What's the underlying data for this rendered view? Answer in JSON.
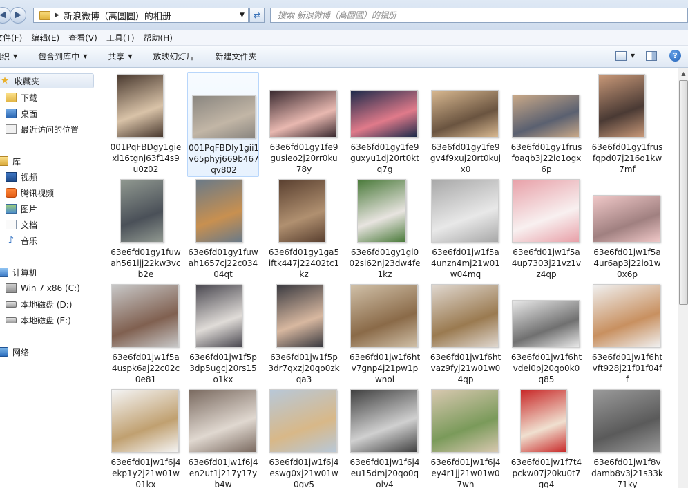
{
  "address": {
    "path_label": "新浪微博（高圆圆）的相册",
    "search_placeholder": "搜索 新浪微博（高圆圆）的相册"
  },
  "menu": [
    "文件(F)",
    "编辑(E)",
    "查看(V)",
    "工具(T)",
    "帮助(H)"
  ],
  "toolbar": {
    "organize": "组织",
    "include_library": "包含到库中",
    "share": "共享",
    "slideshow": "放映幻灯片",
    "new_folder": "新建文件夹"
  },
  "nav": {
    "favorites": "收藏夹",
    "downloads": "下载",
    "desktop": "桌面",
    "recent": "最近访问的位置",
    "libraries": "库",
    "videos": "视频",
    "tencent_video": "腾讯视频",
    "pictures": "图片",
    "documents": "文档",
    "music": "音乐",
    "computer": "计算机",
    "drive_c": "Win 7 x86 (C:)",
    "drive_d": "本地磁盘 (D:)",
    "drive_e": "本地磁盘 (E:)",
    "network": "网络"
  },
  "files": [
    {
      "name": "001PqFBDgy1giexl16tgnj63f14s9u0z02",
      "colors": [
        "#4a3a30",
        "#d9c3a8"
      ]
    },
    {
      "name": "001PqFBDly1gii1v65phyj669b467qv802",
      "colors": [
        "#8a8680",
        "#c2b6a6"
      ]
    },
    {
      "name": "63e6fd01gy1fe9gusieo2j20rr0ku78y",
      "colors": [
        "#3a2a30",
        "#e8b8b0"
      ]
    },
    {
      "name": "63e6fd01gy1fe9guxyu1dj20rt0ktq7g",
      "colors": [
        "#1c2a4a",
        "#e07a8a"
      ]
    },
    {
      "name": "63e6fd01gy1fe9gv4f9xuj20rt0kujx0",
      "colors": [
        "#d8b890",
        "#6a5440"
      ]
    },
    {
      "name": "63e6fd01gy1frusfoaqb3j22io1ogx6p",
      "colors": [
        "#c8a888",
        "#5a6070"
      ]
    },
    {
      "name": "63e6fd01gy1frusfqpd07j216o1kw7mf",
      "colors": [
        "#c89878",
        "#4a3a34"
      ]
    },
    {
      "name": "63e6fd01gy1fuwah561ljj22kw3vcb2e",
      "colors": [
        "#909890",
        "#4a5058"
      ]
    },
    {
      "name": "63e6fd01gy1fuwah1657cj22c03404qt",
      "colors": [
        "#6a7a88",
        "#c89050"
      ]
    },
    {
      "name": "63e6fd01gy1ga5iftk447j22402tc1kz",
      "colors": [
        "#5a4030",
        "#b09070"
      ]
    },
    {
      "name": "63e6fd01gy1gi002sl62nj23dw4fe1kz",
      "colors": [
        "#4a7a3a",
        "#e8e4e0"
      ]
    },
    {
      "name": "63e6fd01jw1f5a4unzn4mj21w01w04mq",
      "colors": [
        "#a8a8a8",
        "#e8e8e8"
      ]
    },
    {
      "name": "63e6fd01jw1f5a4up7303j21vz1vz4qp",
      "colors": [
        "#e8a0a8",
        "#f8f0f0"
      ]
    },
    {
      "name": "63e6fd01jw1f5a4ur6ap3j22io1w0x6p",
      "colors": [
        "#f0c8c8",
        "#a08080"
      ]
    },
    {
      "name": "63e6fd01jw1f5a4uspk6aj22c02c0e81",
      "colors": [
        "#c8c8c8",
        "#806050"
      ]
    },
    {
      "name": "63e6fd01jw1f5p3dp5ugcj20rs15o1kx",
      "colors": [
        "#4a4850",
        "#e0dcd8"
      ]
    },
    {
      "name": "63e6fd01jw1f5p3dr7qxzj20qo0zkqa3",
      "colors": [
        "#3a3a40",
        "#d8b8a0"
      ]
    },
    {
      "name": "63e6fd01jw1f6htv7gnp4j21pw1pwnol",
      "colors": [
        "#d0c0a8",
        "#8a6a48"
      ]
    },
    {
      "name": "63e6fd01jw1f6htvaz9fyj21w01w04qp",
      "colors": [
        "#e0d8d0",
        "#9a7a50"
      ]
    },
    {
      "name": "63e6fd01jw1f6htvdei0pj20qo0k0q85",
      "colors": [
        "#e8e8e8",
        "#707070"
      ]
    },
    {
      "name": "63e6fd01jw1f6htvft928j21f01f04ff",
      "colors": [
        "#f0f0f0",
        "#c89060"
      ]
    },
    {
      "name": "63e6fd01jw1f6j4ekp1y2j21w01w01kx",
      "colors": [
        "#f4f4f4",
        "#c0a070"
      ]
    },
    {
      "name": "63e6fd01jw1f6j4en2ut1j217y17yb4w",
      "colors": [
        "#7a6a60",
        "#e0d8d0"
      ]
    },
    {
      "name": "63e6fd01jw1f6j4eswg0xj21w01w0gv5",
      "colors": [
        "#b8c8d8",
        "#d8b888"
      ]
    },
    {
      "name": "63e6fd01jw1f6j4eu15dmj20qo0qoiv4",
      "colors": [
        "#404040",
        "#d0d0d0"
      ]
    },
    {
      "name": "63e6fd01jw1f6j4ey4r1jj21w01w07wh",
      "colors": [
        "#d8c8b0",
        "#7a9a5a"
      ]
    },
    {
      "name": "63e6fd01jw1f7t4pckw07j20ku0t7gq4",
      "colors": [
        "#c82828",
        "#f0e0d0"
      ]
    },
    {
      "name": "63e6fd01jw1f8vdamb8v3j21s33k71ky",
      "colors": [
        "#9a9a9a",
        "#5a5a5a"
      ]
    }
  ]
}
